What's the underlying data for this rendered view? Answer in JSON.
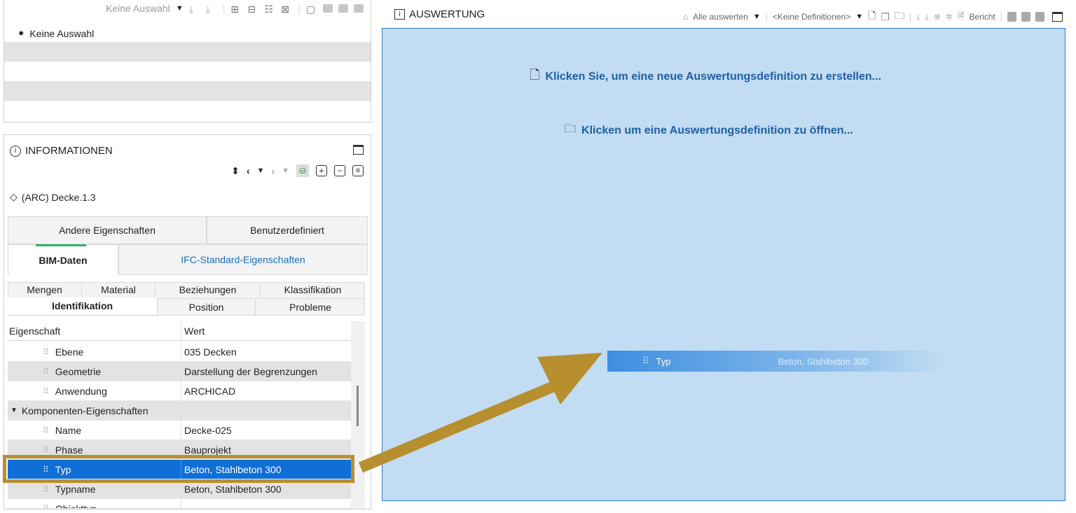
{
  "left_top": {
    "toolbar_label": "Keine Auswahl",
    "item_label": "Keine Auswahl"
  },
  "info": {
    "title": "INFORMATIONEN",
    "object_name": "(ARC) Decke.1.3",
    "tabs_row1": [
      "Andere Eigenschaften",
      "Benutzerdefiniert"
    ],
    "tabs_row2": [
      "BIM-Daten",
      "IFC-Standard-Eigenschaften"
    ],
    "subtabs_row1": [
      "Mengen",
      "Material",
      "Beziehungen",
      "Klassifikation"
    ],
    "subtabs_row2": [
      "Identifikation",
      "Position",
      "Probleme"
    ],
    "columns": [
      "Eigenschaft",
      "Wert"
    ],
    "rows": [
      {
        "name": "Ebene",
        "value": "035 Decken"
      },
      {
        "name": "Geometrie",
        "value": "Darstellung der Begrenzungen"
      },
      {
        "name": "Anwendung",
        "value": "ARCHICAD"
      },
      {
        "name": "Komponenten-Eigenschaften",
        "value": ""
      },
      {
        "name": "Name",
        "value": "Decke-025"
      },
      {
        "name": "Phase",
        "value": "Bauprojekt"
      },
      {
        "name": "Typ",
        "value": "Beton, Stahlbeton 300"
      },
      {
        "name": "Typname",
        "value": "Beton, Stahlbeton 300"
      },
      {
        "name": "Objekttyp",
        "value": ""
      }
    ]
  },
  "auswertung": {
    "title": "AUSWERTUNG",
    "evaluate_all": "Alle auswerten",
    "definitions": "<Keine Definitionen>",
    "report": "Bericht",
    "create_link": "Klicken Sie, um eine neue Auswertungsdefinition zu erstellen...",
    "open_link": "Klicken um eine Auswertungsdefinition zu öffnen...",
    "drag_name": "Typ",
    "drag_value": "Beton, Stahlbeton 300"
  },
  "colors": {
    "accent_blue": "#0f6fd6",
    "panel_blue": "#c2dcf3",
    "arrow_gold": "#b88f2e",
    "tab_green": "#2fb36b"
  }
}
